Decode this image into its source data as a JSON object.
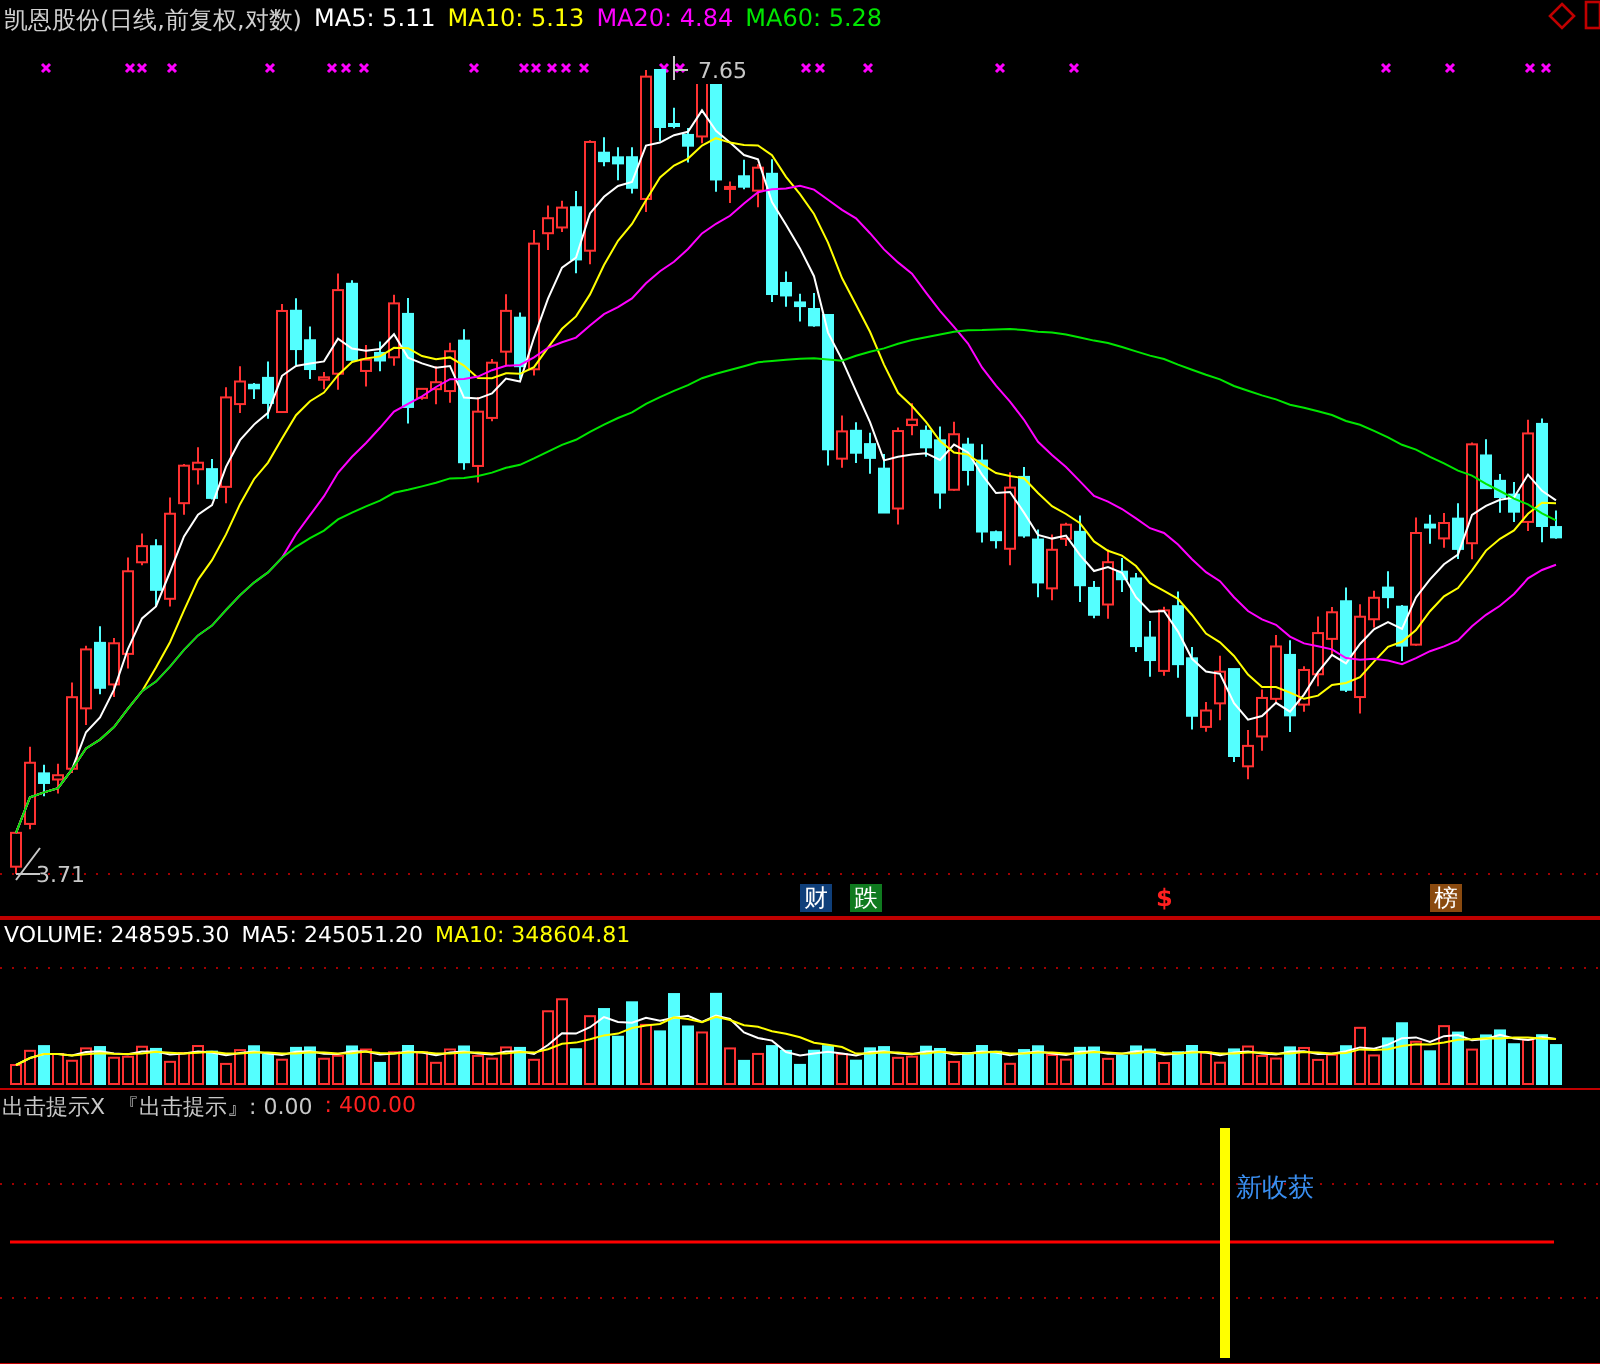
{
  "title": {
    "stock": "凯恩股份(日线,前复权,对数)",
    "ma": [
      {
        "label": "MA5: 5.11",
        "color": "#ffffff"
      },
      {
        "label": "MA10: 5.13",
        "color": "#ffff00"
      },
      {
        "label": "MA20: 4.84",
        "color": "#ff00ff"
      },
      {
        "label": "MA60: 5.28",
        "color": "#00e600"
      }
    ]
  },
  "price_chart": {
    "high_label": "7.65",
    "low_label": "3.71",
    "events": [
      {
        "kind": "badge",
        "text": "财",
        "color": "#0f3f7a"
      },
      {
        "kind": "badge",
        "text": "跌",
        "color": "#0f7a1f"
      },
      {
        "kind": "sign",
        "text": "$",
        "color": "#ff2020"
      },
      {
        "kind": "badge",
        "text": "榜",
        "color": "#8a4a0f"
      }
    ]
  },
  "volume": {
    "labels": [
      {
        "text": "VOLUME: 248595.30",
        "color": "#ffffff"
      },
      {
        "text": "MA5: 245051.20",
        "color": "#ffffff"
      },
      {
        "text": "MA10: 348604.81",
        "color": "#ffff00"
      }
    ]
  },
  "indicator": {
    "name": "出击提示X",
    "labels": [
      {
        "text": "『出击提示』: 0.00",
        "color": "#c8c8c8"
      },
      {
        "text": ": 400.00",
        "color": "#ff2020"
      }
    ],
    "signal": "新收获"
  }
}
